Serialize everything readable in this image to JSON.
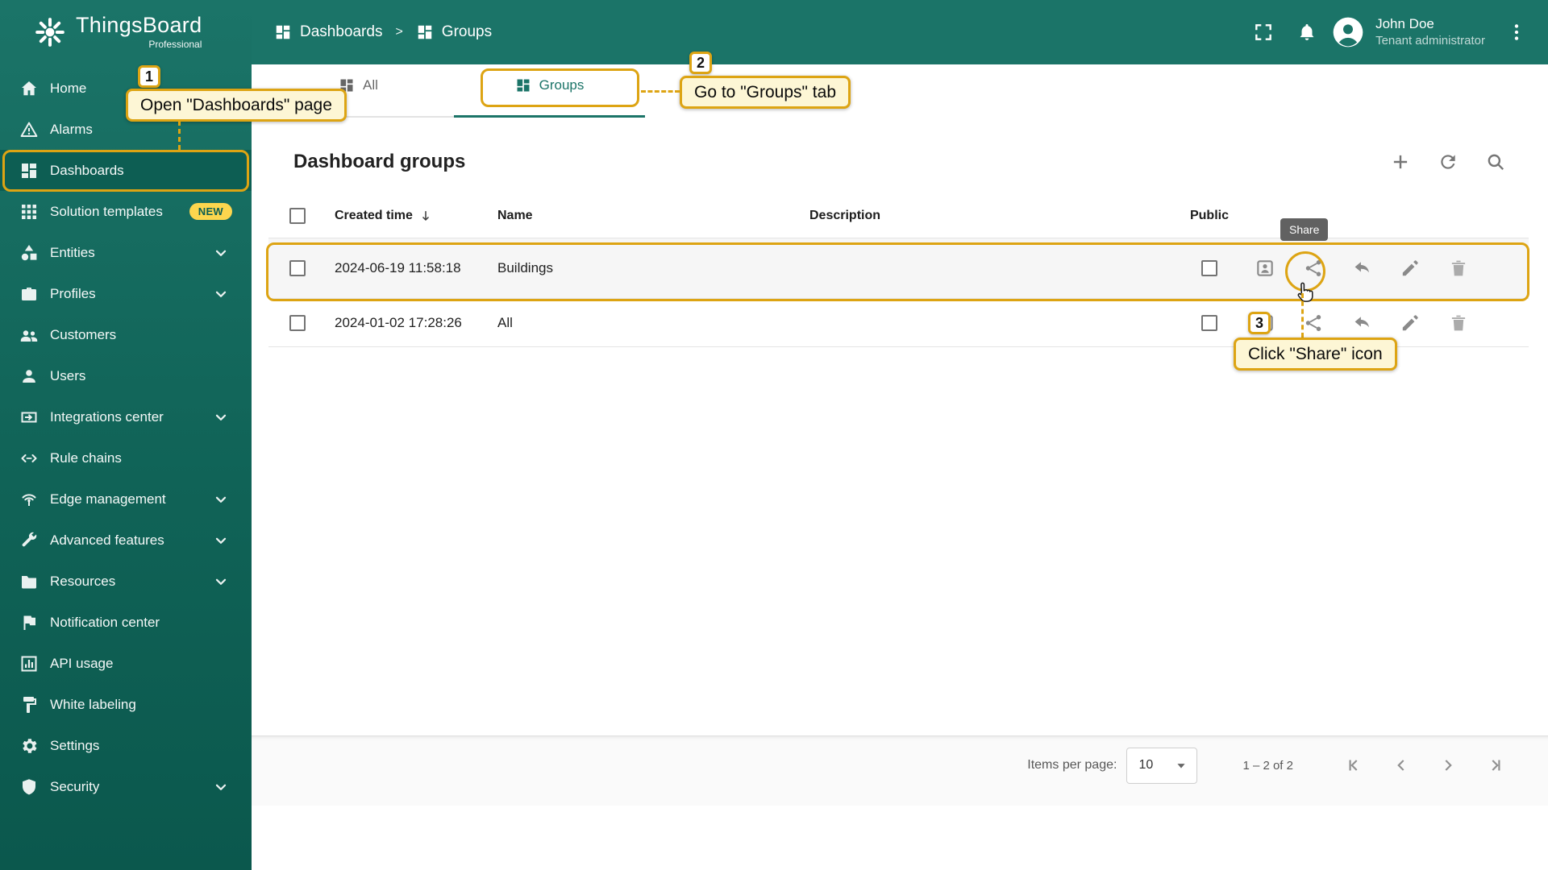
{
  "colors": {
    "primary": "#1b7468",
    "sidebar_active": "#0d5e53",
    "annotation_gold": "#dda413",
    "annotation_bg": "#fdf6d5",
    "tooltip_bg": "#616161",
    "new_badge_bg": "#fdd64e"
  },
  "brand": {
    "name": "ThingsBoard",
    "subtitle": "Professional"
  },
  "topbar": {
    "separator": ">",
    "breadcrumb": [
      {
        "label": "Dashboards"
      },
      {
        "label": "Groups"
      }
    ],
    "user": {
      "name": "John Doe",
      "role": "Tenant administrator"
    }
  },
  "sidebar": {
    "items": [
      {
        "label": "Home",
        "icon": "home-icon"
      },
      {
        "label": "Alarms",
        "icon": "warning-icon"
      },
      {
        "label": "Dashboards",
        "icon": "dashboards-icon",
        "active": true
      },
      {
        "label": "Solution templates",
        "icon": "apps-icon",
        "badge": "NEW"
      },
      {
        "label": "Entities",
        "icon": "category-icon",
        "expandable": true
      },
      {
        "label": "Profiles",
        "icon": "briefcase-icon",
        "expandable": true
      },
      {
        "label": "Customers",
        "icon": "people-icon"
      },
      {
        "label": "Users",
        "icon": "person-icon"
      },
      {
        "label": "Integrations center",
        "icon": "integration-icon",
        "expandable": true
      },
      {
        "label": "Rule chains",
        "icon": "code-brackets-icon"
      },
      {
        "label": "Edge management",
        "icon": "antenna-icon",
        "expandable": true
      },
      {
        "label": "Advanced features",
        "icon": "wrench-icon",
        "expandable": true
      },
      {
        "label": "Resources",
        "icon": "folder-icon",
        "expandable": true
      },
      {
        "label": "Notification center",
        "icon": "flag-icon"
      },
      {
        "label": "API usage",
        "icon": "chart-box-icon"
      },
      {
        "label": "White labeling",
        "icon": "paint-icon"
      },
      {
        "label": "Settings",
        "icon": "gear-icon"
      },
      {
        "label": "Security",
        "icon": "shield-icon",
        "expandable": true
      }
    ]
  },
  "tabs": [
    {
      "label": "All",
      "selected": false
    },
    {
      "label": "Groups",
      "selected": true
    }
  ],
  "table": {
    "title": "Dashboard groups",
    "columns": [
      "Created time",
      "Name",
      "Description",
      "Public"
    ],
    "rows": [
      {
        "created": "2024-06-19 11:58:18",
        "name": "Buildings",
        "description": "",
        "public": false
      },
      {
        "created": "2024-01-02 17:28:26",
        "name": "All",
        "description": "",
        "public": false
      }
    ]
  },
  "tooltip": {
    "share": "Share"
  },
  "paginator": {
    "items_per_page_label": "Items per page:",
    "items_per_page": "10",
    "range": "1 – 2 of 2"
  },
  "annotations": {
    "step1": {
      "number": "1",
      "text": "Open \"Dashboards\" page"
    },
    "step2": {
      "number": "2",
      "text": "Go to \"Groups\" tab"
    },
    "step3": {
      "number": "3",
      "text": "Click \"Share\" icon"
    }
  }
}
